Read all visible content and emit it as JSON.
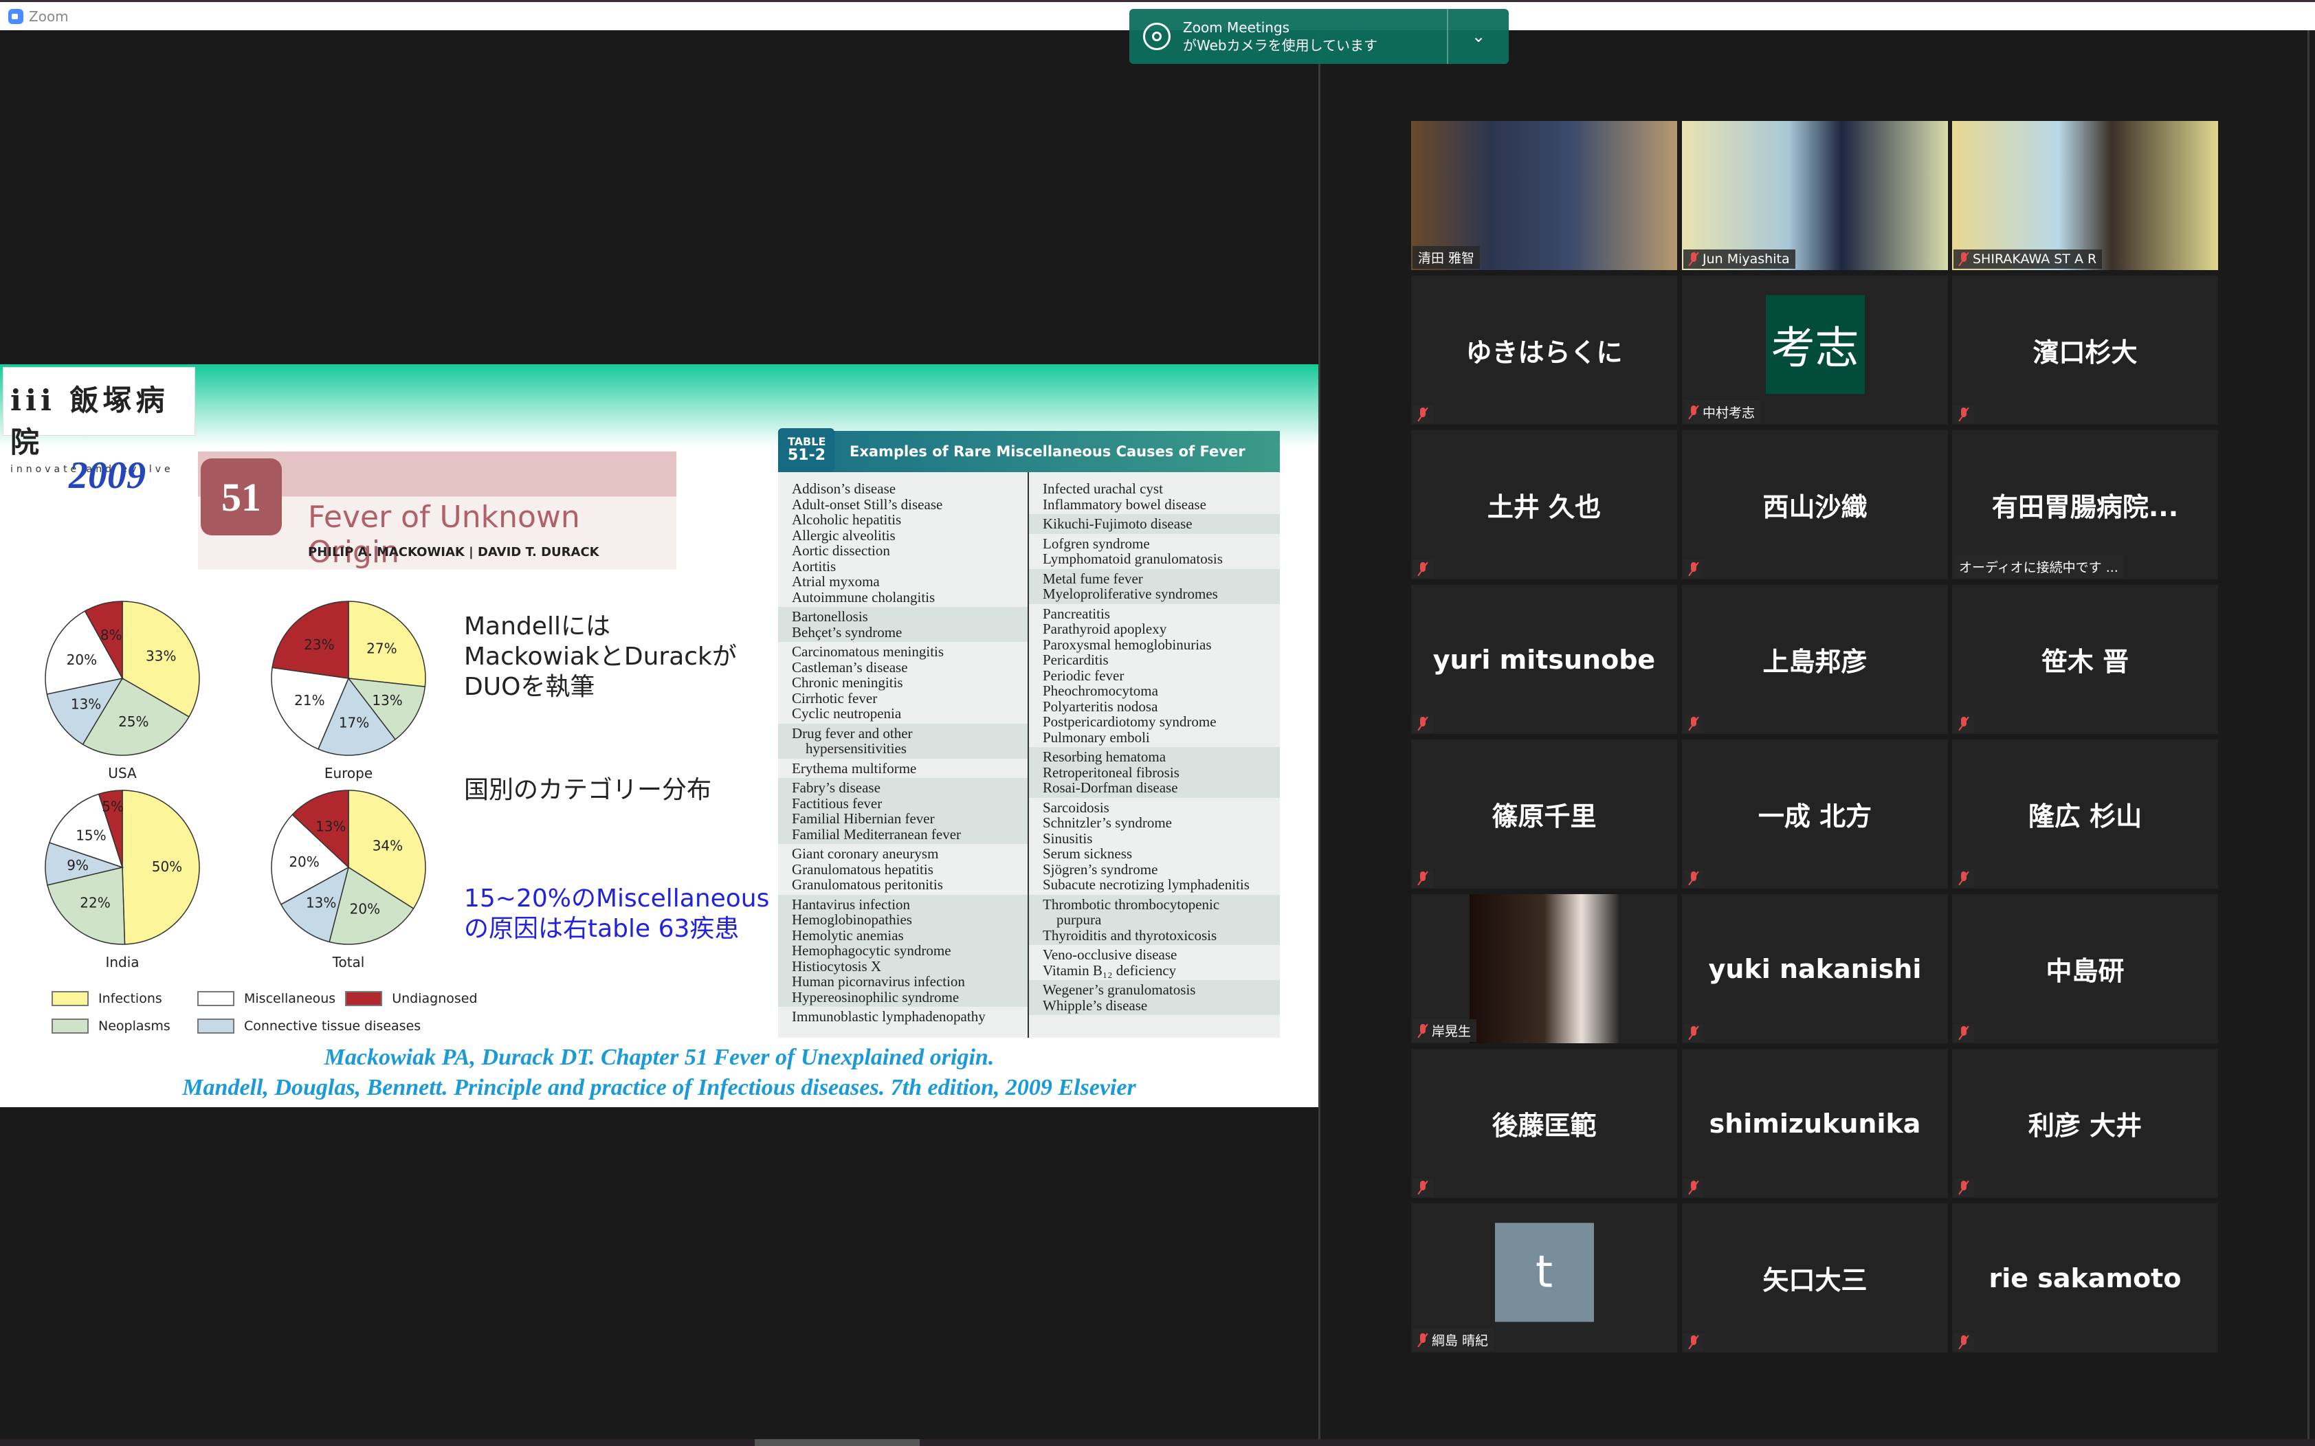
{
  "app": {
    "title": "Zoom"
  },
  "notification": {
    "line1": "Zoom Meetings",
    "line2": "がWebカメラを使用しています",
    "icon": "webcam-icon"
  },
  "slide": {
    "logo": {
      "name": "iii 飯塚病院",
      "tagline": "innovate and evolve"
    },
    "year": "2009",
    "chapter": {
      "number": "51",
      "title": "Fever of Unknown Origin",
      "authors": "PHILIP A. MACKOWIAK  |  DAVID T. DURACK"
    },
    "note1": [
      "Mandellには",
      "MackowiakとDurackが",
      "DUOを執筆"
    ],
    "note2": "国別のカテゴリー分布",
    "note3": [
      "15~20%のMiscellaneous",
      "の原因は右table 63疾患"
    ],
    "table": {
      "tag1": "TABLE",
      "tag2": "51-2",
      "title": "Examples of Rare Miscellaneous Causes of Fever",
      "left": [
        [
          "Addison’s disease",
          "Adult-onset Still’s disease",
          "Alcoholic hepatitis",
          "Allergic alveolitis",
          "Aortic dissection",
          "Aortitis",
          "Atrial myxoma",
          "Autoimmune cholangitis"
        ],
        [
          "Bartonellosis",
          "Behçet’s syndrome"
        ],
        [
          "Carcinomatous meningitis",
          "Castleman’s disease",
          "Chronic meningitis",
          "Cirrhotic fever",
          "Cyclic neutropenia"
        ],
        [
          "Drug fever and other",
          "~hypersensitivities"
        ],
        [
          "Erythema multiforme"
        ],
        [
          "Fabry’s disease",
          "Factitious fever",
          "Familial Hibernian fever",
          "Familial Mediterranean fever"
        ],
        [
          "Giant coronary aneurysm",
          "Granulomatous hepatitis",
          "Granulomatous peritonitis"
        ],
        [
          "Hantavirus infection",
          "Hemoglobinopathies",
          "Hemolytic anemias",
          "Hemophagocytic syndrome",
          "Histiocytosis X",
          "Human picornavirus infection",
          "Hypereosinophilic syndrome"
        ],
        [
          "Immunoblastic lymphadenopathy"
        ]
      ],
      "right": [
        [
          "Infected urachal cyst",
          "Inflammatory bowel disease"
        ],
        [
          "Kikuchi-Fujimoto disease"
        ],
        [
          "Lofgren syndrome",
          "Lymphomatoid granulomatosis"
        ],
        [
          "Metal fume fever",
          "Myeloproliferative syndromes"
        ],
        [
          "Pancreatitis",
          "Parathyroid apoplexy",
          "Paroxysmal hemoglobinurias",
          "Pericarditis",
          "Periodic fever",
          "Pheochromocytoma",
          "Polyarteritis nodosa",
          "Postpericardiotomy syndrome",
          "Pulmonary emboli"
        ],
        [
          "Resorbing hematoma",
          "Retroperitoneal fibrosis",
          "Rosai-Dorfman disease"
        ],
        [
          "Sarcoidosis",
          "Schnitzler’s syndrome",
          "Sinusitis",
          "Serum sickness",
          "Sjögren’s syndrome",
          "Subacute necrotizing lymphadenitis"
        ],
        [
          "Thrombotic thrombocytopenic",
          "~purpura",
          "Thyroiditis and thyrotoxicosis"
        ],
        [
          "Veno-occlusive disease",
          "Vitamin B₁₂ deficiency"
        ],
        [
          "Wegener’s granulomatosis",
          "Whipple’s disease"
        ]
      ]
    },
    "citation": [
      "Mackowiak PA, Durack DT. Chapter 51 Fever of Unexplained origin.",
      "Mandell, Douglas, Bennett. Principle and practice of Infectious diseases. 7th edition, 2009 Elsevier"
    ],
    "legend": [
      {
        "label": "Infections",
        "color": "#fdf59a"
      },
      {
        "label": "Miscellaneous",
        "color": "#ffffff"
      },
      {
        "label": "Undiagnosed",
        "color": "#b0272d"
      },
      {
        "label": "Neoplasms",
        "color": "#cfe3c8"
      },
      {
        "label": "Connective tissue diseases",
        "color": "#c5d9e6"
      }
    ]
  },
  "chart_data": [
    {
      "type": "pie",
      "title": "USA",
      "categories": [
        "Infections",
        "Neoplasms",
        "Connective tissue diseases",
        "Miscellaneous",
        "Undiagnosed"
      ],
      "values": [
        33,
        25,
        13,
        20,
        8
      ]
    },
    {
      "type": "pie",
      "title": "Europe",
      "categories": [
        "Infections",
        "Neoplasms",
        "Connective tissue diseases",
        "Miscellaneous",
        "Undiagnosed"
      ],
      "values": [
        27,
        13,
        17,
        21,
        23
      ]
    },
    {
      "type": "pie",
      "title": "India",
      "categories": [
        "Infections",
        "Neoplasms",
        "Connective tissue diseases",
        "Miscellaneous",
        "Undiagnosed"
      ],
      "values": [
        50,
        22,
        9,
        15,
        5
      ]
    },
    {
      "type": "pie",
      "title": "Total",
      "categories": [
        "Infections",
        "Neoplasms",
        "Connective tissue diseases",
        "Miscellaneous",
        "Undiagnosed"
      ],
      "values": [
        34,
        20,
        13,
        20,
        13
      ]
    }
  ],
  "participants": [
    {
      "kind": "video",
      "label": "清田 雅智",
      "muted": false,
      "active": true
    },
    {
      "kind": "video",
      "label": "Jun Miyashita",
      "muted": true
    },
    {
      "kind": "video",
      "label": "SHIRAKAWA ST A R",
      "muted": true
    },
    {
      "kind": "name",
      "name": "ゆきはらくに",
      "muted": true
    },
    {
      "kind": "avatar",
      "avatar": "考志",
      "avatar_color": "#024c3a",
      "label": "中村考志",
      "muted": true
    },
    {
      "kind": "name",
      "name": "濱口杉大",
      "muted": true
    },
    {
      "kind": "name",
      "name": "土井 久也",
      "muted": true
    },
    {
      "kind": "name",
      "name": "西山沙織",
      "muted": true
    },
    {
      "kind": "name",
      "name": "有田胃腸病院...",
      "label": "オーディオに接続中です ...",
      "muted": false
    },
    {
      "kind": "name",
      "name": "yuri mitsunobe",
      "muted": true
    },
    {
      "kind": "name",
      "name": "上島邦彦",
      "muted": true
    },
    {
      "kind": "name",
      "name": "笹木 晋",
      "muted": true
    },
    {
      "kind": "name",
      "name": "篠原千里",
      "muted": true
    },
    {
      "kind": "name",
      "name": "一成 北方",
      "muted": true
    },
    {
      "kind": "name",
      "name": "隆広 杉山",
      "muted": true
    },
    {
      "kind": "video",
      "label": "岸晃生",
      "muted": true,
      "narrow": true
    },
    {
      "kind": "name",
      "name": "yuki nakanishi",
      "muted": true
    },
    {
      "kind": "name",
      "name": "中島研",
      "muted": true
    },
    {
      "kind": "name",
      "name": "後藤匡範",
      "muted": true
    },
    {
      "kind": "name",
      "name": "shimizukunika",
      "muted": true
    },
    {
      "kind": "name",
      "name": "利彦 大井",
      "muted": true
    },
    {
      "kind": "avatar",
      "avatar": "t",
      "avatar_color": "#788f9b",
      "label": "綱島 晴紀",
      "muted": true
    },
    {
      "kind": "name",
      "name": "矢口大三",
      "muted": true
    },
    {
      "kind": "name",
      "name": "rie sakamoto",
      "muted": true
    }
  ]
}
